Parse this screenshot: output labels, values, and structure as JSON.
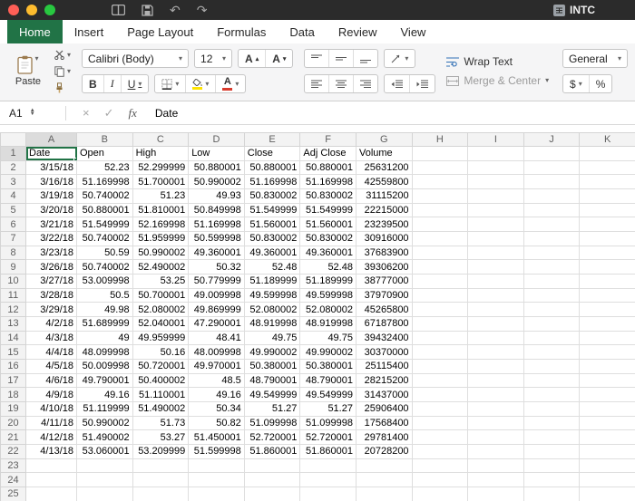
{
  "window": {
    "title": "INTC"
  },
  "tabs": [
    "Home",
    "Insert",
    "Page Layout",
    "Formulas",
    "Data",
    "Review",
    "View"
  ],
  "active_tab": "Home",
  "ribbon": {
    "paste": "Paste",
    "font_name": "Calibri (Body)",
    "font_size": "12",
    "bold": "B",
    "italic": "I",
    "underline": "U",
    "font_increase": "A",
    "font_decrease": "A",
    "font_color_letter": "A",
    "wrap_text": "Wrap Text",
    "merge_center": "Merge & Center",
    "number_format": "General",
    "currency": "$",
    "percent": "%"
  },
  "formula_bar": {
    "name_box": "A1",
    "cancel": "×",
    "confirm": "✓",
    "fx": "fx",
    "content": "Date"
  },
  "icons": {
    "caret": "▾",
    "up_triangle": "▴",
    "down_triangle": "▾",
    "undo": "↶",
    "redo": "↷",
    "stepper_up": "▲",
    "stepper_down": "▼"
  },
  "colors": {
    "excel_green": "#217346",
    "traffic_red": "#ff5f57",
    "traffic_yellow": "#febc2e",
    "traffic_green": "#28c840"
  },
  "grid": {
    "selected_cell": "A1",
    "columns": [
      "A",
      "B",
      "C",
      "D",
      "E",
      "F",
      "G",
      "H",
      "I",
      "J",
      "K"
    ],
    "row_numbers": [
      "1",
      "2",
      "3",
      "4",
      "5",
      "6",
      "7",
      "8",
      "9",
      "10",
      "11",
      "12",
      "13",
      "14",
      "15",
      "16",
      "17",
      "18",
      "19",
      "20",
      "21",
      "22",
      "23",
      "24",
      "25"
    ],
    "rows": [
      [
        "Date",
        "Open",
        "High",
        "Low",
        "Close",
        "Adj Close",
        "Volume"
      ],
      [
        "3/15/18",
        "52.23",
        "52.299999",
        "50.880001",
        "50.880001",
        "50.880001",
        "25631200"
      ],
      [
        "3/16/18",
        "51.169998",
        "51.700001",
        "50.990002",
        "51.169998",
        "51.169998",
        "42559800"
      ],
      [
        "3/19/18",
        "50.740002",
        "51.23",
        "49.93",
        "50.830002",
        "50.830002",
        "31115200"
      ],
      [
        "3/20/18",
        "50.880001",
        "51.810001",
        "50.849998",
        "51.549999",
        "51.549999",
        "22215000"
      ],
      [
        "3/21/18",
        "51.549999",
        "52.169998",
        "51.169998",
        "51.560001",
        "51.560001",
        "23239500"
      ],
      [
        "3/22/18",
        "50.740002",
        "51.959999",
        "50.599998",
        "50.830002",
        "50.830002",
        "30916000"
      ],
      [
        "3/23/18",
        "50.59",
        "50.990002",
        "49.360001",
        "49.360001",
        "49.360001",
        "37683900"
      ],
      [
        "3/26/18",
        "50.740002",
        "52.490002",
        "50.32",
        "52.48",
        "52.48",
        "39306200"
      ],
      [
        "3/27/18",
        "53.009998",
        "53.25",
        "50.779999",
        "51.189999",
        "51.189999",
        "38777000"
      ],
      [
        "3/28/18",
        "50.5",
        "50.700001",
        "49.009998",
        "49.599998",
        "49.599998",
        "37970900"
      ],
      [
        "3/29/18",
        "49.98",
        "52.080002",
        "49.869999",
        "52.080002",
        "52.080002",
        "45265800"
      ],
      [
        "4/2/18",
        "51.689999",
        "52.040001",
        "47.290001",
        "48.919998",
        "48.919998",
        "67187800"
      ],
      [
        "4/3/18",
        "49",
        "49.959999",
        "48.41",
        "49.75",
        "49.75",
        "39432400"
      ],
      [
        "4/4/18",
        "48.099998",
        "50.16",
        "48.009998",
        "49.990002",
        "49.990002",
        "30370000"
      ],
      [
        "4/5/18",
        "50.009998",
        "50.720001",
        "49.970001",
        "50.380001",
        "50.380001",
        "25115400"
      ],
      [
        "4/6/18",
        "49.790001",
        "50.400002",
        "48.5",
        "48.790001",
        "48.790001",
        "28215200"
      ],
      [
        "4/9/18",
        "49.16",
        "51.110001",
        "49.16",
        "49.549999",
        "49.549999",
        "31437000"
      ],
      [
        "4/10/18",
        "51.119999",
        "51.490002",
        "50.34",
        "51.27",
        "51.27",
        "25906400"
      ],
      [
        "4/11/18",
        "50.990002",
        "51.73",
        "50.82",
        "51.099998",
        "51.099998",
        "17568400"
      ],
      [
        "4/12/18",
        "51.490002",
        "53.27",
        "51.450001",
        "52.720001",
        "52.720001",
        "29781400"
      ],
      [
        "4/13/18",
        "53.060001",
        "53.209999",
        "51.599998",
        "51.860001",
        "51.860001",
        "20728200"
      ]
    ]
  }
}
